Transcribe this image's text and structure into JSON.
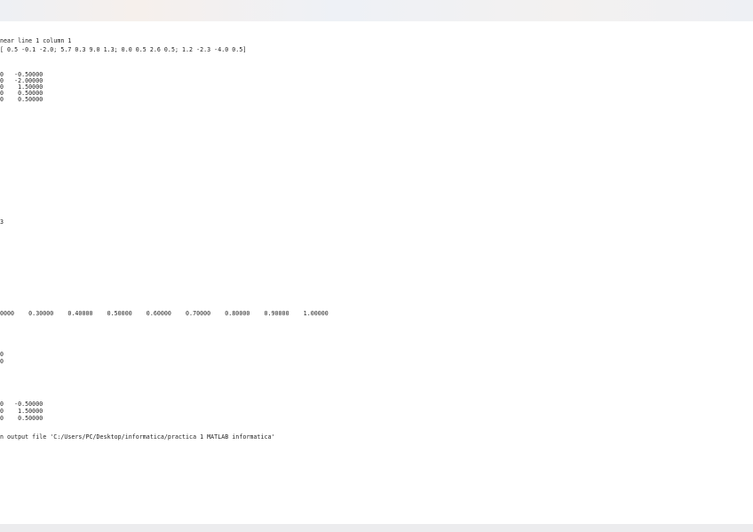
{
  "window": {
    "title": ""
  },
  "console": {
    "lines": [
      "near line 1 column 1",
      "[ 0.5 -0.1 -2.0; 5.7 0.3 9.0 1.3; 0.0 0.5 2.6 0.5; 1.2 -2.3 -4.0 0.5]",
      "0   -0.50000",
      "0   -2.00000",
      "0    1.50000",
      "0    0.50000",
      "0    0.50000",
      "3",
      "0000    0.30000    0.40000    0.50000    0.60000    0.70000    0.80000    0.90000    1.00000",
      "0",
      "0",
      "0   -0.50000",
      "0    1.50000",
      "0    0.50000",
      "n output file 'C:/Users/PC/Desktop/informatica/practica 1 MATLAB informatica'"
    ]
  }
}
